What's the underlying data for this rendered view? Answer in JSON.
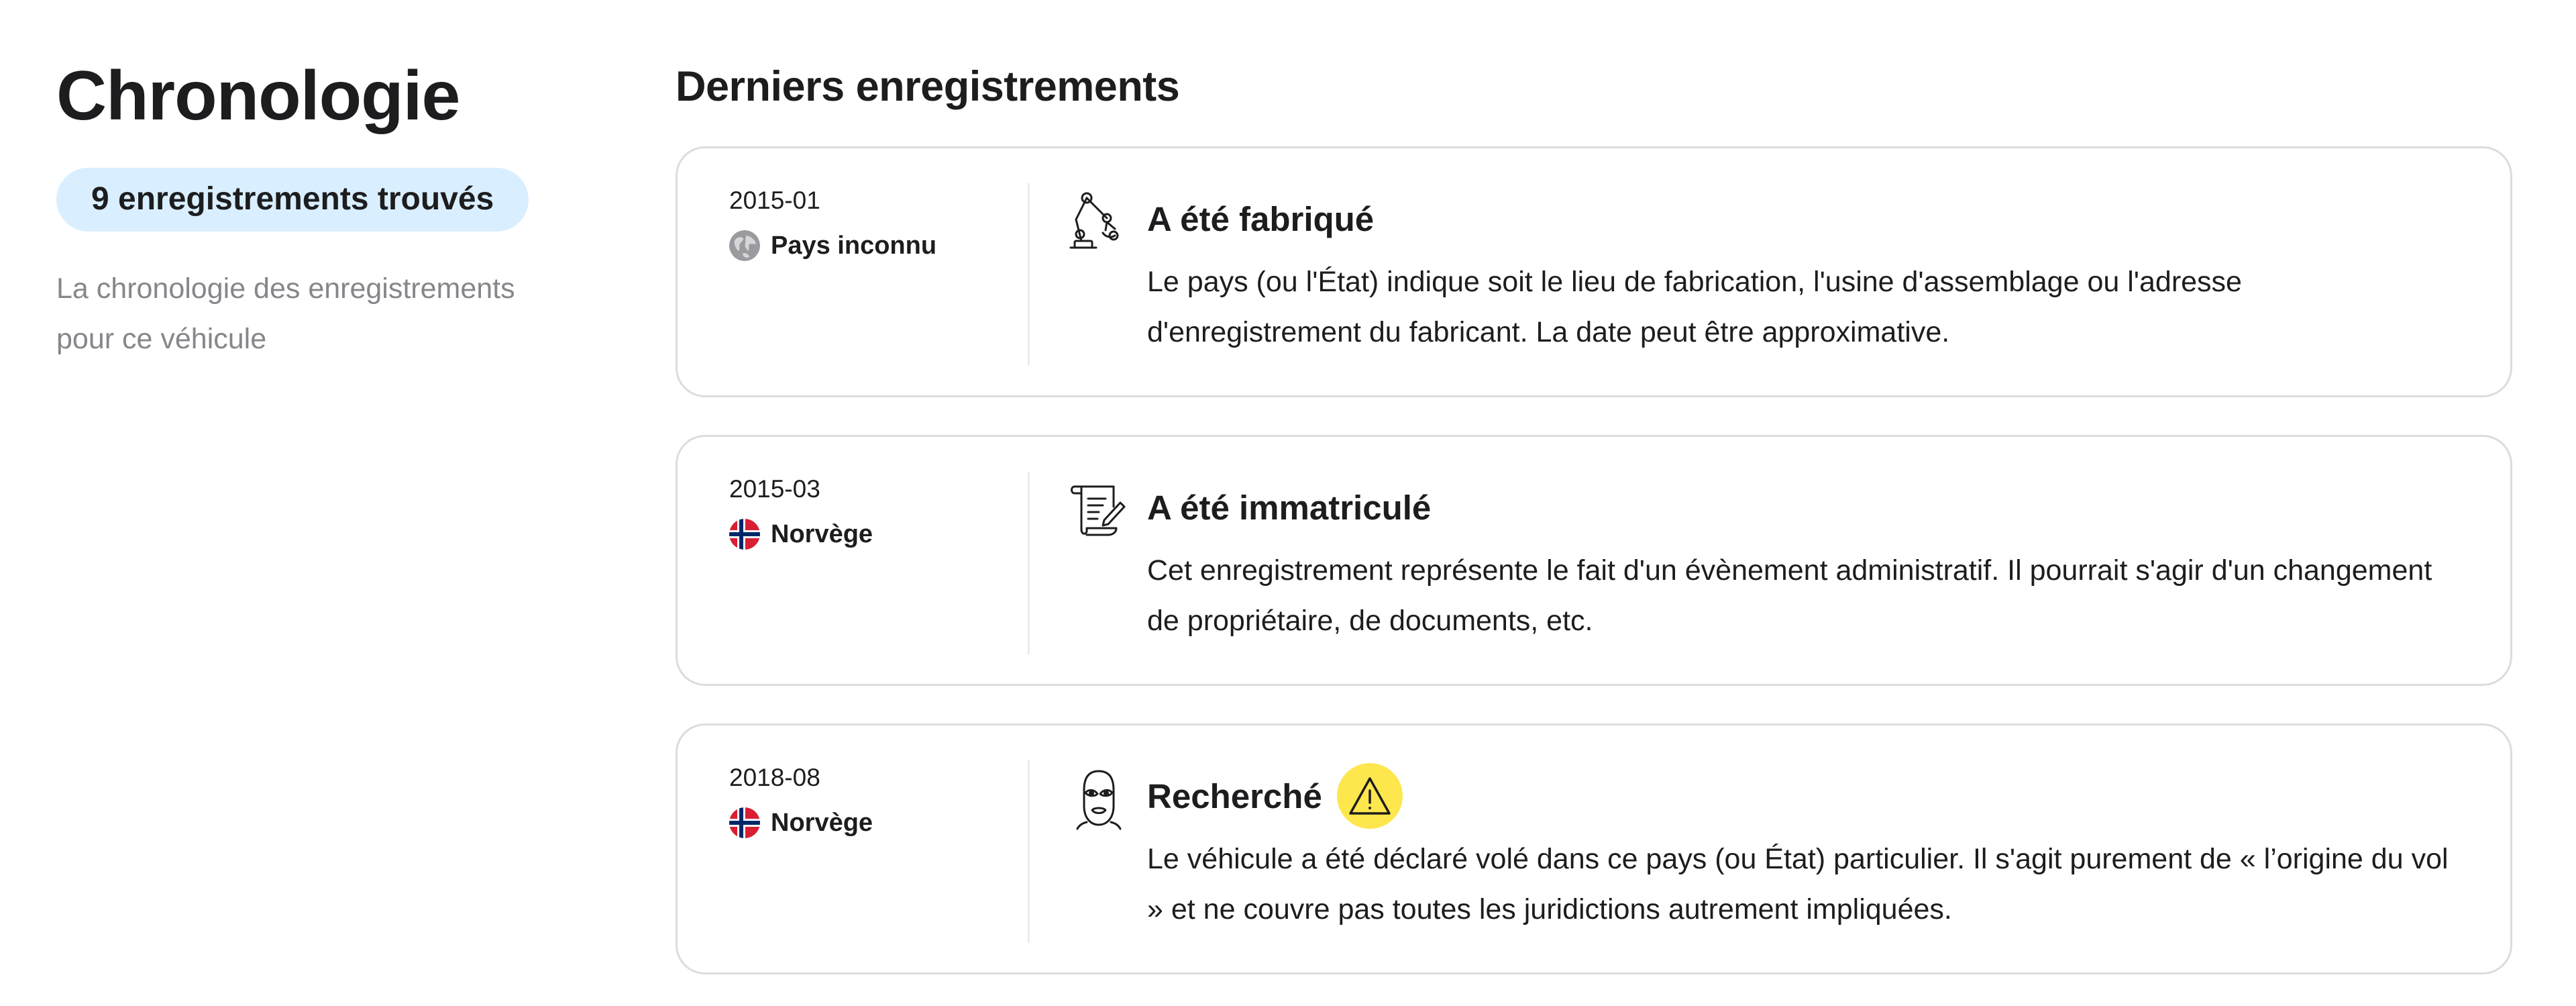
{
  "sidebar": {
    "title": "Chronologie",
    "count_badge": "9 enregistrements trouvés",
    "description": "La chronologie des enregistrements pour ce véhicule"
  },
  "main": {
    "section_title": "Derniers enregistrements",
    "records": [
      {
        "date": "2015-01",
        "country": "Pays inconnu",
        "country_icon": "globe-icon",
        "event_icon": "robot-arm-icon",
        "title": "A été fabriqué",
        "text": "Le pays (ou l'État) indique soit le lieu de fabrication, l'usine d'assemblage ou l'adresse d'enregistrement du fabricant. La date peut être approximative."
      },
      {
        "date": "2015-03",
        "country": "Norvège",
        "country_icon": "norway-flag-icon",
        "event_icon": "document-scroll-icon",
        "title": "A été immatriculé",
        "text": "Cet enregistrement représente le fait d'un évènement administratif. Il pourrait s'agir d'un changement de propriétaire, de documents, etc."
      },
      {
        "date": "2018-08",
        "country": "Norvège",
        "country_icon": "norway-flag-icon",
        "event_icon": "balaclava-thief-icon",
        "title": "Recherché",
        "warning_icon": "warning-triangle-icon",
        "text": "Le véhicule a été déclaré volé dans ce pays (ou État) particulier. Il s'agit purement de « l’origine du vol » et ne couvre pas toutes les juridictions autrement impliquées."
      }
    ]
  },
  "colors": {
    "badge_background": "#d9efff",
    "warning_yellow": "#fde74c",
    "muted_text": "#86868b",
    "card_border": "#dcdcdf",
    "norway_red": "#d91f33",
    "norway_blue": "#002868"
  }
}
